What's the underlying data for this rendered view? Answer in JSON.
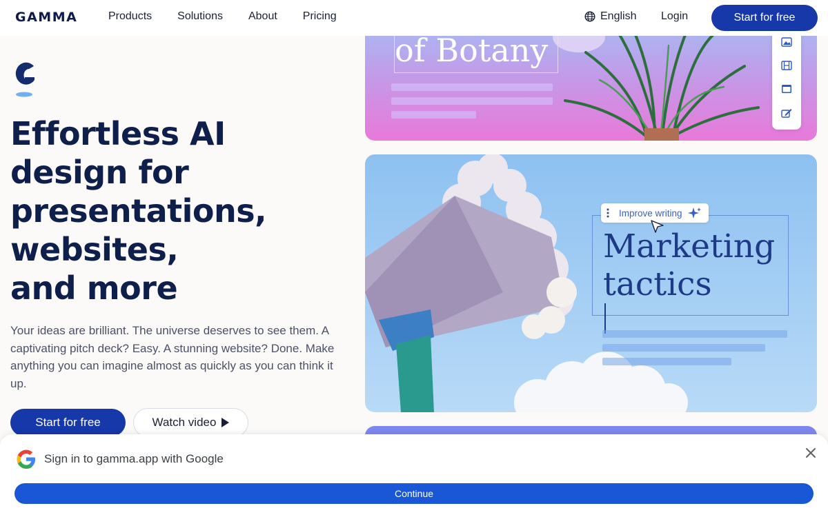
{
  "header": {
    "logo": "GAMMA",
    "nav": [
      "Products",
      "Solutions",
      "About",
      "Pricing"
    ],
    "language": "English",
    "login": "Login",
    "cta": "Start for free"
  },
  "hero": {
    "headline": [
      "Effortless AI",
      "design for",
      "presentations,",
      "websites,",
      "and more"
    ],
    "subtext": "Your ideas are brilliant. The universe deserves to see them. A captivating pitch deck? Easy. A stunning website? Done. Make anything you can imagine almost as quickly as you can think it up.",
    "primary_cta": "Start for free",
    "secondary_cta": "Watch video"
  },
  "cards": {
    "botany_title": "of Botany",
    "toolbar_icons": [
      "image-icon",
      "film-icon",
      "window-icon",
      "edit-icon"
    ],
    "marketing_title": [
      "Marketing",
      "tactics"
    ],
    "ai_pill": "Improve writing"
  },
  "google_signin": {
    "title": "Sign in to gamma.app with Google",
    "continue": "Continue"
  },
  "colors": {
    "brand": "#1638a8",
    "google_blue": "#1a57d6",
    "headline": "#0f1f4b"
  }
}
